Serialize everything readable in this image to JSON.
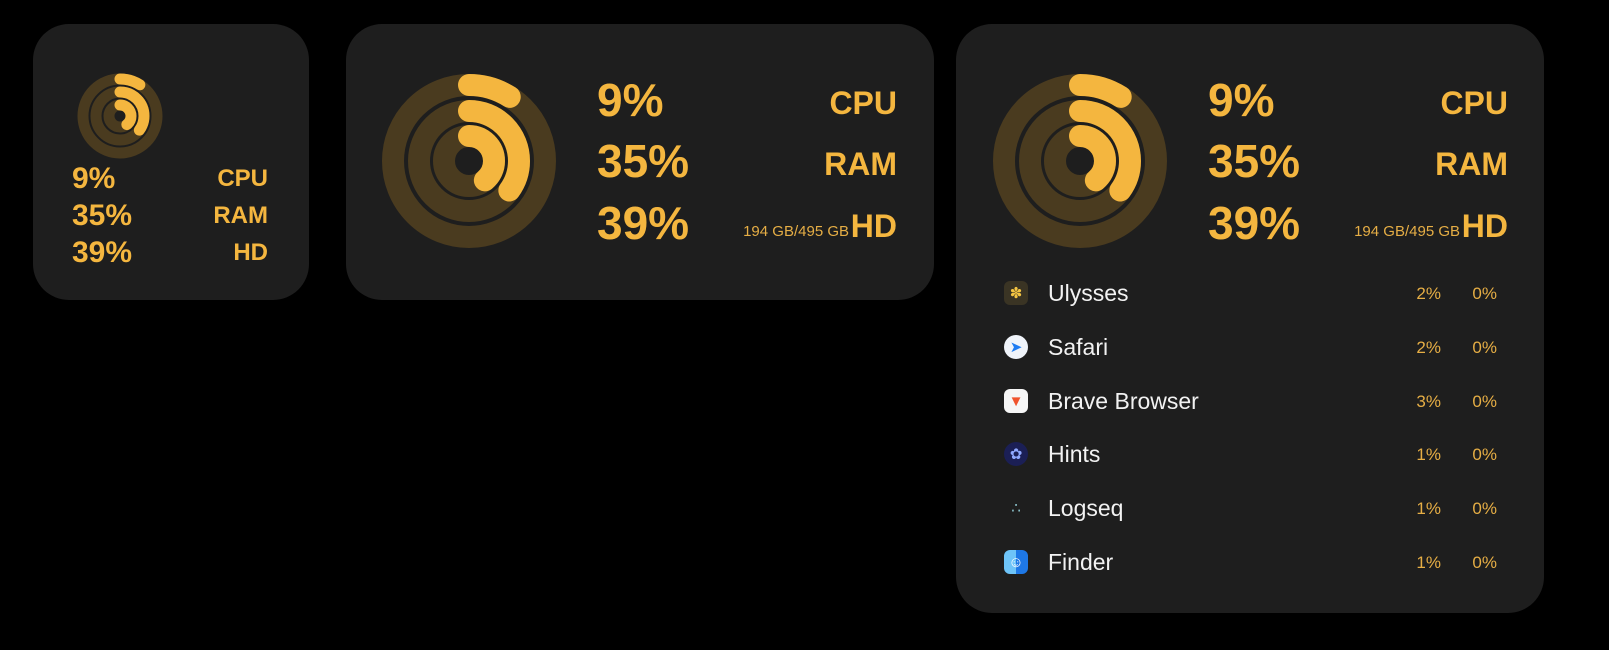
{
  "theme": {
    "accent": "#F4B63F",
    "track": "#4A3B1F",
    "widget_bg": "#1E1E1E",
    "page_bg": "#000000"
  },
  "stats": {
    "cpu": {
      "label": "CPU",
      "value": "9%",
      "fraction": 0.09
    },
    "ram": {
      "label": "RAM",
      "value": "35%",
      "fraction": 0.35
    },
    "hd": {
      "label": "HD",
      "value": "39%",
      "fraction": 0.39,
      "detail": "194 GB/495 GB"
    }
  },
  "processes": [
    {
      "name": "Ulysses",
      "cpu": "2%",
      "ram": "0%",
      "icon": "butterfly-icon"
    },
    {
      "name": "Safari",
      "cpu": "2%",
      "ram": "0%",
      "icon": "compass-icon"
    },
    {
      "name": "Brave Browser",
      "cpu": "3%",
      "ram": "0%",
      "icon": "lion-shield-icon"
    },
    {
      "name": "Hints",
      "cpu": "1%",
      "ram": "0%",
      "icon": "feather-icon"
    },
    {
      "name": "Logseq",
      "cpu": "1%",
      "ram": "0%",
      "icon": "dots-icon"
    },
    {
      "name": "Finder",
      "cpu": "1%",
      "ram": "0%",
      "icon": "finder-face-icon"
    }
  ]
}
